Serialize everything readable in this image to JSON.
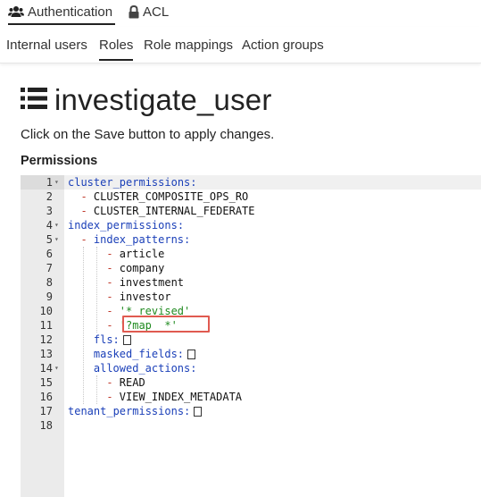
{
  "top_tabs": [
    {
      "label": "Authentication",
      "icon": "users-icon",
      "active": true
    },
    {
      "label": "ACL",
      "icon": "lock-icon",
      "active": false
    }
  ],
  "sub_tabs": [
    {
      "label": "Internal users",
      "active": false
    },
    {
      "label": "Roles",
      "active": true
    },
    {
      "label": "Role mappings",
      "active": false
    },
    {
      "label": "Action groups",
      "active": false
    }
  ],
  "page": {
    "title": "investigate_user",
    "title_icon": "list-icon",
    "instructions": "Click on the Save button to apply changes.",
    "section_label": "Permissions"
  },
  "editor": {
    "lines": [
      {
        "n": "1",
        "fold": true,
        "tokens": [
          {
            "t": "cluster_permissions:",
            "c": "key"
          }
        ]
      },
      {
        "n": "2",
        "fold": false,
        "tokens": [
          {
            "t": "- ",
            "c": "dash"
          },
          {
            "t": "CLUSTER_COMPOSITE_OPS_RO",
            "c": "plain"
          }
        ]
      },
      {
        "n": "3",
        "fold": false,
        "tokens": [
          {
            "t": "- ",
            "c": "dash"
          },
          {
            "t": "CLUSTER_INTERNAL_FEDERATE",
            "c": "plain"
          }
        ]
      },
      {
        "n": "4",
        "fold": true,
        "tokens": [
          {
            "t": "index_permissions:",
            "c": "key"
          }
        ]
      },
      {
        "n": "5",
        "fold": true,
        "tokens": [
          {
            "t": "- ",
            "c": "dash"
          },
          {
            "t": "index_patterns:",
            "c": "key"
          }
        ]
      },
      {
        "n": "6",
        "fold": false,
        "tokens": [
          {
            "t": "- ",
            "c": "dash"
          },
          {
            "t": "article",
            "c": "plain"
          }
        ]
      },
      {
        "n": "7",
        "fold": false,
        "tokens": [
          {
            "t": "- ",
            "c": "dash"
          },
          {
            "t": "company",
            "c": "plain"
          }
        ]
      },
      {
        "n": "8",
        "fold": false,
        "tokens": [
          {
            "t": "- ",
            "c": "dash"
          },
          {
            "t": "investment",
            "c": "plain"
          }
        ]
      },
      {
        "n": "9",
        "fold": false,
        "tokens": [
          {
            "t": "- ",
            "c": "dash"
          },
          {
            "t": "investor",
            "c": "plain"
          }
        ]
      },
      {
        "n": "10",
        "fold": false,
        "tokens": [
          {
            "t": "- ",
            "c": "dash"
          },
          {
            "t": "'* revised'",
            "c": "str"
          }
        ]
      },
      {
        "n": "11",
        "fold": false,
        "tokens": [
          {
            "t": "- ",
            "c": "dash"
          },
          {
            "t": "'?map__*'",
            "c": "str"
          }
        ]
      },
      {
        "n": "12",
        "fold": false,
        "tokens": [
          {
            "t": "fls:",
            "c": "key"
          }
        ],
        "empty_list": true
      },
      {
        "n": "13",
        "fold": false,
        "tokens": [
          {
            "t": "masked_fields:",
            "c": "key"
          }
        ],
        "empty_list": true
      },
      {
        "n": "14",
        "fold": true,
        "tokens": [
          {
            "t": "allowed_actions:",
            "c": "key"
          }
        ]
      },
      {
        "n": "15",
        "fold": false,
        "tokens": [
          {
            "t": "- ",
            "c": "dash"
          },
          {
            "t": "READ",
            "c": "plain"
          }
        ]
      },
      {
        "n": "16",
        "fold": false,
        "tokens": [
          {
            "t": "- ",
            "c": "dash"
          },
          {
            "t": "VIEW_INDEX_METADATA",
            "c": "plain"
          }
        ]
      },
      {
        "n": "17",
        "fold": false,
        "tokens": [
          {
            "t": "tenant_permissions:",
            "c": "key"
          }
        ],
        "empty_list": true
      },
      {
        "n": "18",
        "fold": false,
        "tokens": []
      }
    ],
    "highlighted_line": "11",
    "colors": {
      "key": "#1a3fb8",
      "dash": "#c0392b",
      "string": "#1f8a1f",
      "highlight": "#e05a50"
    }
  }
}
